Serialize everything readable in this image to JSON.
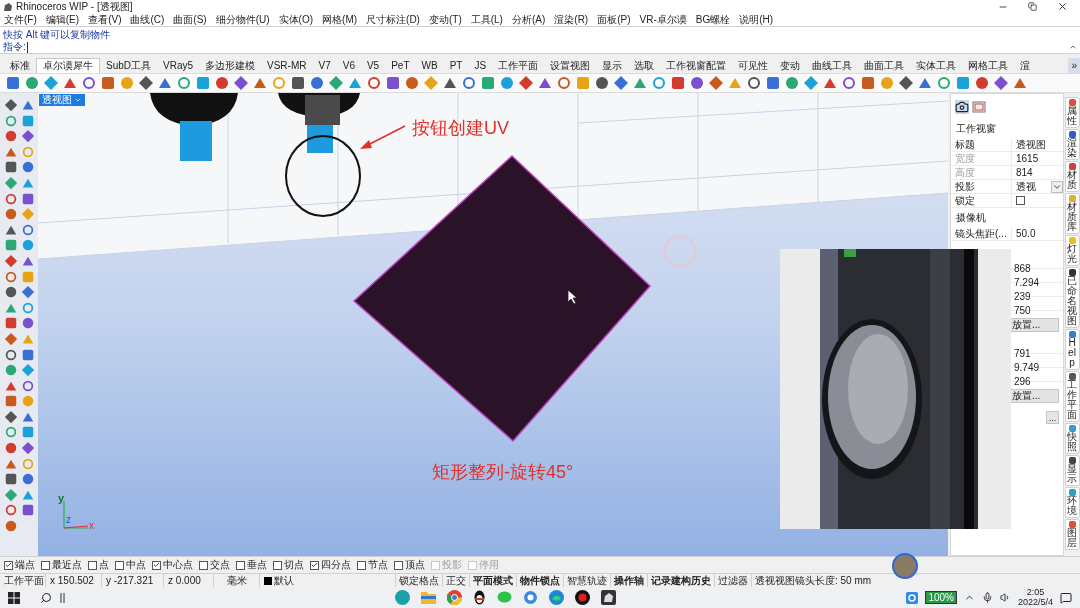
{
  "window": {
    "title": "Rhinoceros WIP - [透视图]"
  },
  "menu": [
    "文件(F)",
    "编辑(E)",
    "查看(V)",
    "曲线(C)",
    "曲面(S)",
    "细分物件(U)",
    "实体(O)",
    "网格(M)",
    "尺寸标注(D)",
    "变动(T)",
    "工具(L)",
    "分析(A)",
    "渲染(R)",
    "面板(P)",
    "VR-卓尔谟",
    "BG螺栓",
    "说明(H)"
  ],
  "command": {
    "history": "快按 Alt 键可以复制物件",
    "prompt": "指令:"
  },
  "toolbar_tabs": [
    {
      "label": "标准",
      "selected": false
    },
    {
      "label": "卓尔谟犀牛",
      "selected": true
    },
    {
      "label": "SubD工具",
      "selected": false
    },
    {
      "label": "VRay5",
      "selected": false
    },
    {
      "label": "多边形建模",
      "selected": false
    },
    {
      "label": "VSR-MR",
      "selected": false
    },
    {
      "label": "V7",
      "selected": false
    },
    {
      "label": "V6",
      "selected": false
    },
    {
      "label": "V5",
      "selected": false
    },
    {
      "label": "PeT",
      "selected": false
    },
    {
      "label": "WB",
      "selected": false
    },
    {
      "label": "PT",
      "selected": false
    },
    {
      "label": "JS",
      "selected": false
    },
    {
      "label": "工作平面",
      "selected": false
    },
    {
      "label": "设置视图",
      "selected": false
    },
    {
      "label": "显示",
      "selected": false
    },
    {
      "label": "选取",
      "selected": false
    },
    {
      "label": "工作视窗配置",
      "selected": false
    },
    {
      "label": "可见性",
      "selected": false
    },
    {
      "label": "变动",
      "selected": false
    },
    {
      "label": "曲线工具",
      "selected": false
    },
    {
      "label": "曲面工具",
      "selected": false
    },
    {
      "label": "实体工具",
      "selected": false
    },
    {
      "label": "网格工具",
      "selected": false
    },
    {
      "label": "渲",
      "selected": false
    }
  ],
  "tabs_overflow": "»",
  "viewport": {
    "label": "透视图",
    "annotations": [
      "按钮创建UV",
      "矩形整列-旋转45°"
    ],
    "axes": {
      "x": "x",
      "y": "y",
      "z": "z"
    }
  },
  "panel": {
    "title": "工作视窗",
    "rows": [
      {
        "kind": "text",
        "label": "标题",
        "value": "透视图",
        "disabled": false
      },
      {
        "kind": "text",
        "label": "宽度",
        "value": "1615",
        "disabled": true
      },
      {
        "kind": "text",
        "label": "高度",
        "value": "814",
        "disabled": true
      },
      {
        "kind": "dropdown",
        "label": "投影",
        "value": "透视",
        "disabled": false
      },
      {
        "kind": "checkbox",
        "label": "锁定",
        "checked": false,
        "disabled": false
      }
    ],
    "camera_title": "摄像机",
    "camera_rows": [
      {
        "kind": "text",
        "label": "镜头焦距(...",
        "value": "50.0",
        "disabled": false
      }
    ],
    "fragments": [
      {
        "kind": "value",
        "value": "868"
      },
      {
        "kind": "value",
        "value": "7.294"
      },
      {
        "kind": "value",
        "value": "239"
      },
      {
        "kind": "value",
        "value": "750"
      },
      {
        "kind": "button",
        "label": "放置..."
      },
      {
        "kind": "value",
        "value": "791"
      },
      {
        "kind": "value",
        "value": "9.749"
      },
      {
        "kind": "value",
        "value": "296"
      },
      {
        "kind": "button",
        "label": "放置..."
      },
      {
        "kind": "browse",
        "label": "..."
      }
    ]
  },
  "side_tabs": [
    "属性",
    "渲染",
    "材质",
    "材质库",
    "灯光",
    "已命名视图",
    "Help",
    "工作平面",
    "快照",
    "显示",
    "环境",
    "图层"
  ],
  "osnaps": [
    {
      "label": "端点",
      "checked": true,
      "disabled": false
    },
    {
      "label": "最近点",
      "checked": false,
      "disabled": false
    },
    {
      "label": "点",
      "checked": false,
      "disabled": false
    },
    {
      "label": "中点",
      "checked": false,
      "disabled": false
    },
    {
      "label": "中心点",
      "checked": true,
      "disabled": false
    },
    {
      "label": "交点",
      "checked": false,
      "disabled": false
    },
    {
      "label": "垂点",
      "checked": false,
      "disabled": false
    },
    {
      "label": "切点",
      "checked": false,
      "disabled": false
    },
    {
      "label": "四分点",
      "checked": true,
      "disabled": false
    },
    {
      "label": "节点",
      "checked": false,
      "disabled": false
    },
    {
      "label": "顶点",
      "checked": false,
      "disabled": false
    },
    {
      "label": "投影",
      "checked": false,
      "disabled": true
    },
    {
      "label": "停用",
      "checked": false,
      "disabled": true
    }
  ],
  "status": {
    "cells": [
      "工作平面",
      "x 150.502",
      "y -217.321",
      "z 0.000",
      "毫米"
    ],
    "layer": {
      "label": "默认",
      "color": "#000000"
    },
    "toggles": [
      {
        "label": "锁定格点",
        "on": false
      },
      {
        "label": "正交",
        "on": false
      },
      {
        "label": "平面模式",
        "on": true
      },
      {
        "label": "物件锁点",
        "on": true
      },
      {
        "label": "智慧轨迹",
        "on": false
      },
      {
        "label": "操作轴",
        "on": true
      },
      {
        "label": "记录建构历史",
        "on": true
      },
      {
        "label": "过滤器",
        "on": false
      }
    ],
    "message": "透视视图镜头长度: 50 mm"
  },
  "taskbar": {
    "battery": "100%",
    "time": "2:05",
    "date": "2022/5/4"
  }
}
